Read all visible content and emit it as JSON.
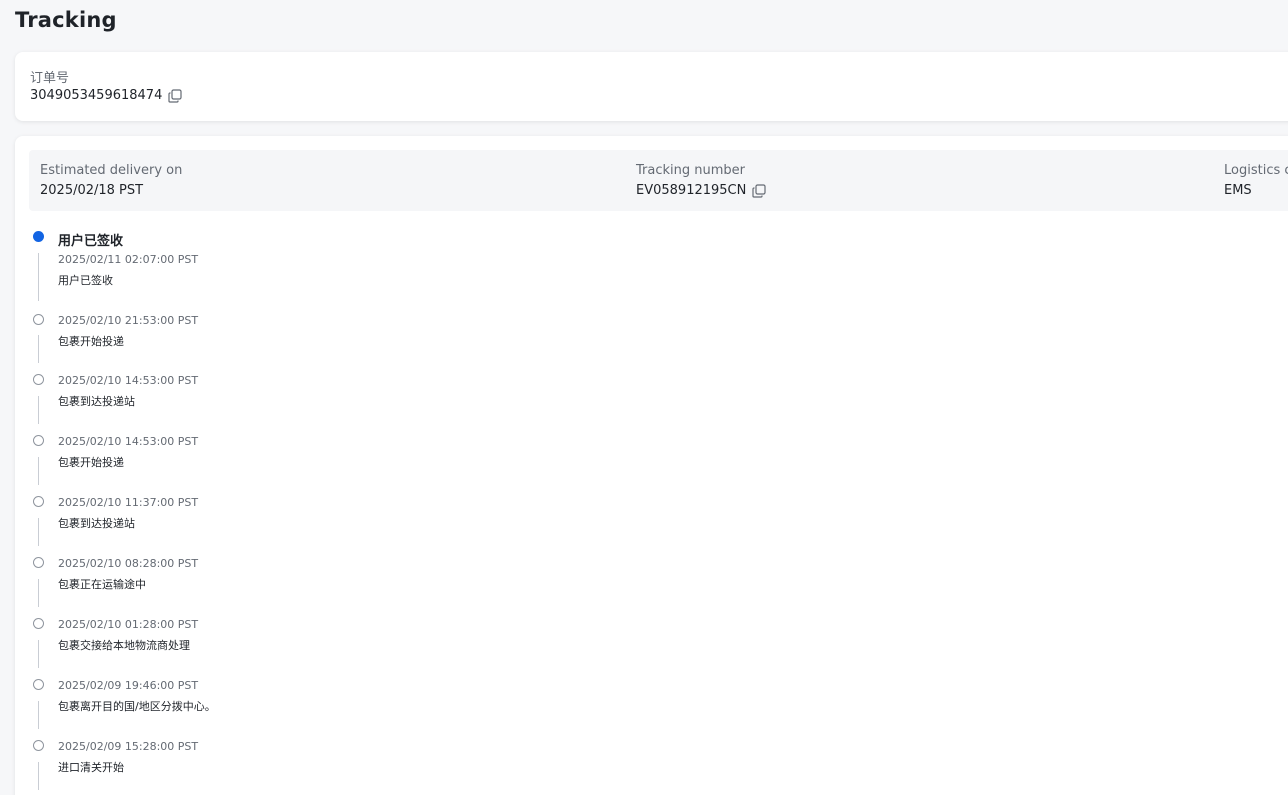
{
  "page": {
    "title": "Tracking"
  },
  "order": {
    "label": "订单号",
    "number": "3049053459618474"
  },
  "shipment": {
    "estimated_label": "Estimated delivery on",
    "estimated_value": "2025/02/18 PST",
    "tracking_label": "Tracking number",
    "tracking_value": "EV058912195CN",
    "carrier_label": "Logistics carrier",
    "carrier_value": "EMS"
  },
  "colors": {
    "accent": "#1264e3"
  },
  "icons": {
    "copy": "copy-icon"
  },
  "timeline": {
    "current_status": "用户已签收",
    "events": [
      {
        "time": "2025/02/11 02:07:00 PST",
        "desc": "用户已签收"
      },
      {
        "time": "2025/02/10 21:53:00 PST",
        "desc": "包裹开始投递"
      },
      {
        "time": "2025/02/10 14:53:00 PST",
        "desc": "包裹到达投递站"
      },
      {
        "time": "2025/02/10 14:53:00 PST",
        "desc": "包裹开始投递"
      },
      {
        "time": "2025/02/10 11:37:00 PST",
        "desc": "包裹到达投递站"
      },
      {
        "time": "2025/02/10 08:28:00 PST",
        "desc": "包裹正在运输途中"
      },
      {
        "time": "2025/02/10 01:28:00 PST",
        "desc": "包裹交接给本地物流商处理"
      },
      {
        "time": "2025/02/09 19:46:00 PST",
        "desc": "包裹离开目的国/地区分拨中心。"
      },
      {
        "time": "2025/02/09 15:28:00 PST",
        "desc": "进口清关开始"
      }
    ]
  }
}
